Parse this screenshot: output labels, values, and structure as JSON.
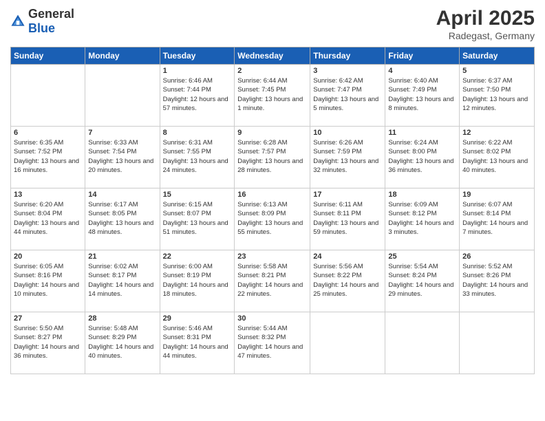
{
  "logo": {
    "general": "General",
    "blue": "Blue"
  },
  "title": "April 2025",
  "subtitle": "Radegast, Germany",
  "weekdays": [
    "Sunday",
    "Monday",
    "Tuesday",
    "Wednesday",
    "Thursday",
    "Friday",
    "Saturday"
  ],
  "weeks": [
    [
      {
        "day": "",
        "info": ""
      },
      {
        "day": "",
        "info": ""
      },
      {
        "day": "1",
        "info": "Sunrise: 6:46 AM\nSunset: 7:44 PM\nDaylight: 12 hours and 57 minutes."
      },
      {
        "day": "2",
        "info": "Sunrise: 6:44 AM\nSunset: 7:45 PM\nDaylight: 13 hours and 1 minute."
      },
      {
        "day": "3",
        "info": "Sunrise: 6:42 AM\nSunset: 7:47 PM\nDaylight: 13 hours and 5 minutes."
      },
      {
        "day": "4",
        "info": "Sunrise: 6:40 AM\nSunset: 7:49 PM\nDaylight: 13 hours and 8 minutes."
      },
      {
        "day": "5",
        "info": "Sunrise: 6:37 AM\nSunset: 7:50 PM\nDaylight: 13 hours and 12 minutes."
      }
    ],
    [
      {
        "day": "6",
        "info": "Sunrise: 6:35 AM\nSunset: 7:52 PM\nDaylight: 13 hours and 16 minutes."
      },
      {
        "day": "7",
        "info": "Sunrise: 6:33 AM\nSunset: 7:54 PM\nDaylight: 13 hours and 20 minutes."
      },
      {
        "day": "8",
        "info": "Sunrise: 6:31 AM\nSunset: 7:55 PM\nDaylight: 13 hours and 24 minutes."
      },
      {
        "day": "9",
        "info": "Sunrise: 6:28 AM\nSunset: 7:57 PM\nDaylight: 13 hours and 28 minutes."
      },
      {
        "day": "10",
        "info": "Sunrise: 6:26 AM\nSunset: 7:59 PM\nDaylight: 13 hours and 32 minutes."
      },
      {
        "day": "11",
        "info": "Sunrise: 6:24 AM\nSunset: 8:00 PM\nDaylight: 13 hours and 36 minutes."
      },
      {
        "day": "12",
        "info": "Sunrise: 6:22 AM\nSunset: 8:02 PM\nDaylight: 13 hours and 40 minutes."
      }
    ],
    [
      {
        "day": "13",
        "info": "Sunrise: 6:20 AM\nSunset: 8:04 PM\nDaylight: 13 hours and 44 minutes."
      },
      {
        "day": "14",
        "info": "Sunrise: 6:17 AM\nSunset: 8:05 PM\nDaylight: 13 hours and 48 minutes."
      },
      {
        "day": "15",
        "info": "Sunrise: 6:15 AM\nSunset: 8:07 PM\nDaylight: 13 hours and 51 minutes."
      },
      {
        "day": "16",
        "info": "Sunrise: 6:13 AM\nSunset: 8:09 PM\nDaylight: 13 hours and 55 minutes."
      },
      {
        "day": "17",
        "info": "Sunrise: 6:11 AM\nSunset: 8:11 PM\nDaylight: 13 hours and 59 minutes."
      },
      {
        "day": "18",
        "info": "Sunrise: 6:09 AM\nSunset: 8:12 PM\nDaylight: 14 hours and 3 minutes."
      },
      {
        "day": "19",
        "info": "Sunrise: 6:07 AM\nSunset: 8:14 PM\nDaylight: 14 hours and 7 minutes."
      }
    ],
    [
      {
        "day": "20",
        "info": "Sunrise: 6:05 AM\nSunset: 8:16 PM\nDaylight: 14 hours and 10 minutes."
      },
      {
        "day": "21",
        "info": "Sunrise: 6:02 AM\nSunset: 8:17 PM\nDaylight: 14 hours and 14 minutes."
      },
      {
        "day": "22",
        "info": "Sunrise: 6:00 AM\nSunset: 8:19 PM\nDaylight: 14 hours and 18 minutes."
      },
      {
        "day": "23",
        "info": "Sunrise: 5:58 AM\nSunset: 8:21 PM\nDaylight: 14 hours and 22 minutes."
      },
      {
        "day": "24",
        "info": "Sunrise: 5:56 AM\nSunset: 8:22 PM\nDaylight: 14 hours and 25 minutes."
      },
      {
        "day": "25",
        "info": "Sunrise: 5:54 AM\nSunset: 8:24 PM\nDaylight: 14 hours and 29 minutes."
      },
      {
        "day": "26",
        "info": "Sunrise: 5:52 AM\nSunset: 8:26 PM\nDaylight: 14 hours and 33 minutes."
      }
    ],
    [
      {
        "day": "27",
        "info": "Sunrise: 5:50 AM\nSunset: 8:27 PM\nDaylight: 14 hours and 36 minutes."
      },
      {
        "day": "28",
        "info": "Sunrise: 5:48 AM\nSunset: 8:29 PM\nDaylight: 14 hours and 40 minutes."
      },
      {
        "day": "29",
        "info": "Sunrise: 5:46 AM\nSunset: 8:31 PM\nDaylight: 14 hours and 44 minutes."
      },
      {
        "day": "30",
        "info": "Sunrise: 5:44 AM\nSunset: 8:32 PM\nDaylight: 14 hours and 47 minutes."
      },
      {
        "day": "",
        "info": ""
      },
      {
        "day": "",
        "info": ""
      },
      {
        "day": "",
        "info": ""
      }
    ]
  ]
}
